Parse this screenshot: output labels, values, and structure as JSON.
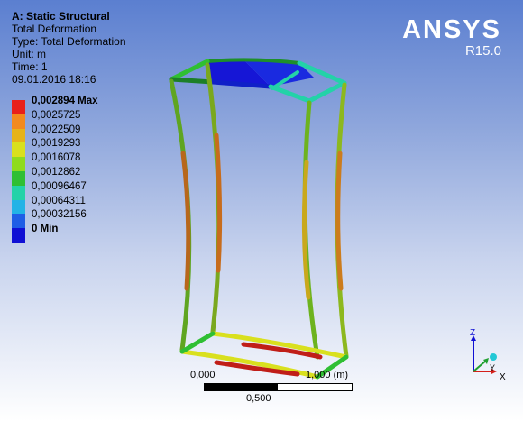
{
  "info": {
    "title": "A: Static Structural",
    "lines": [
      "Total Deformation",
      "Type: Total Deformation",
      "Unit: m",
      "Time: 1",
      "09.01.2016 18:16"
    ]
  },
  "legend": {
    "items": [
      {
        "label": "0,002894 Max",
        "color": "#e8201a",
        "bold": true
      },
      {
        "label": "0,0025725",
        "color": "#f28a1e",
        "bold": false
      },
      {
        "label": "0,0022509",
        "color": "#e6b31a",
        "bold": false
      },
      {
        "label": "0,0019293",
        "color": "#d9e01e",
        "bold": false
      },
      {
        "label": "0,0016078",
        "color": "#8fdb1e",
        "bold": false
      },
      {
        "label": "0,0012862",
        "color": "#2fbf33",
        "bold": false
      },
      {
        "label": "0,00096467",
        "color": "#23d2a8",
        "bold": false
      },
      {
        "label": "0,00064311",
        "color": "#22b3e6",
        "bold": false
      },
      {
        "label": "0,00032156",
        "color": "#1f5ee6",
        "bold": false
      },
      {
        "label": "0 Min",
        "color": "#1010d4",
        "bold": true
      }
    ]
  },
  "brand": {
    "name": "ANSYS",
    "version": "R15.0"
  },
  "scale": {
    "left": "0,000",
    "right": "1,000 (m)",
    "mid": "0,500"
  },
  "triad": {
    "z": "Z",
    "x": "X",
    "y": "Y"
  }
}
